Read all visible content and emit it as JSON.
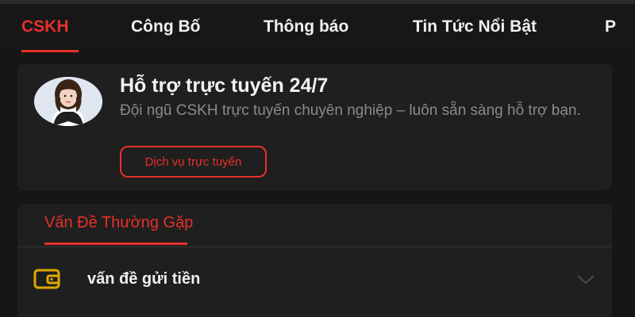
{
  "tabs": [
    {
      "label": "CSKH",
      "active": true
    },
    {
      "label": "Công Bố",
      "active": false
    },
    {
      "label": "Thông báo",
      "active": false
    },
    {
      "label": "Tin Tức Nổi Bật",
      "active": false
    },
    {
      "label": "P",
      "active": false
    }
  ],
  "support": {
    "title": "Hỗ trợ trực tuyến 24/7",
    "description": "Đội ngũ CSKH trực tuyến chuyên nghiệp – luôn sẵn sàng hỗ trợ bạn.",
    "button_label": "Dịch vụ trực tuyến"
  },
  "faq": {
    "tab_label": "Vấn Đề Thường Gặp",
    "items": [
      {
        "label": "vấn đề gửi tiền",
        "icon": "wallet-icon"
      }
    ]
  },
  "colors": {
    "accent": "#e8302a",
    "background": "#161616",
    "card": "#1f1f1f",
    "icon": "#e0a800"
  }
}
